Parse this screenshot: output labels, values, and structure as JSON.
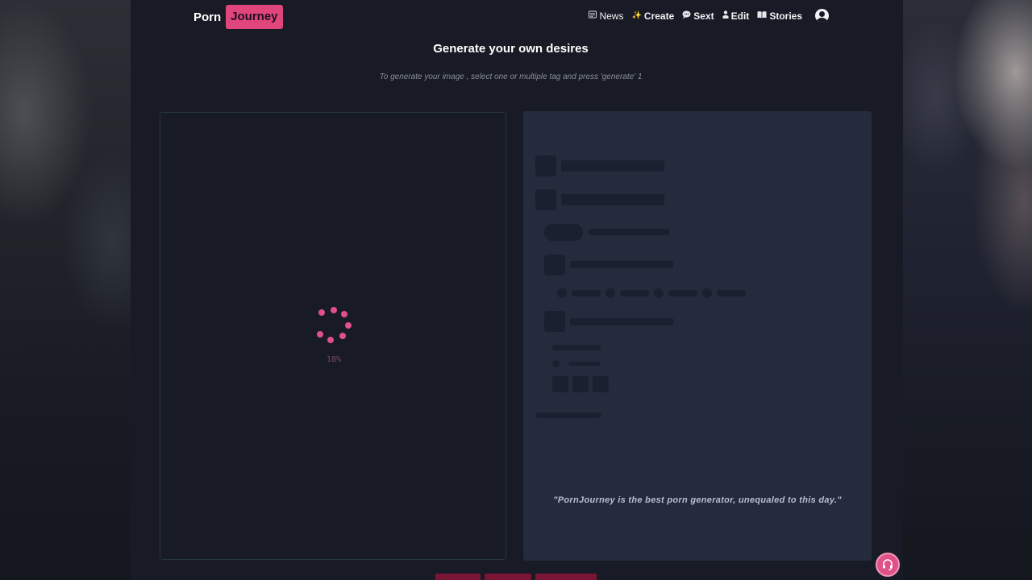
{
  "header": {
    "logo_part1": "Porn",
    "logo_part2": "Journey",
    "brand_color": "#e0457b",
    "nav": [
      {
        "label": "News",
        "icon": "newspaper-icon"
      },
      {
        "label": "Create",
        "icon": "sparkles-icon"
      },
      {
        "label": "Sext",
        "icon": "chat-bubble-icon"
      },
      {
        "label": "Edit",
        "icon": "person-icon"
      },
      {
        "label": "Stories",
        "icon": "book-icon"
      }
    ],
    "account_icon": "user-circle-icon"
  },
  "page": {
    "title": "Generate your own desires",
    "subtitle": "To generate your image , select one or multiple tag and press 'generate' 1"
  },
  "generator": {
    "progress_text": "18%",
    "progress_fraction": 0.18,
    "spinner_color": "#e0518a"
  },
  "options_panel": {
    "state": "loading-skeleton",
    "quote": "\"PornJourney is the best porn generator, unequaled to this day.\""
  },
  "support": {
    "icon": "headset-support-icon",
    "color": "#e0518a"
  }
}
